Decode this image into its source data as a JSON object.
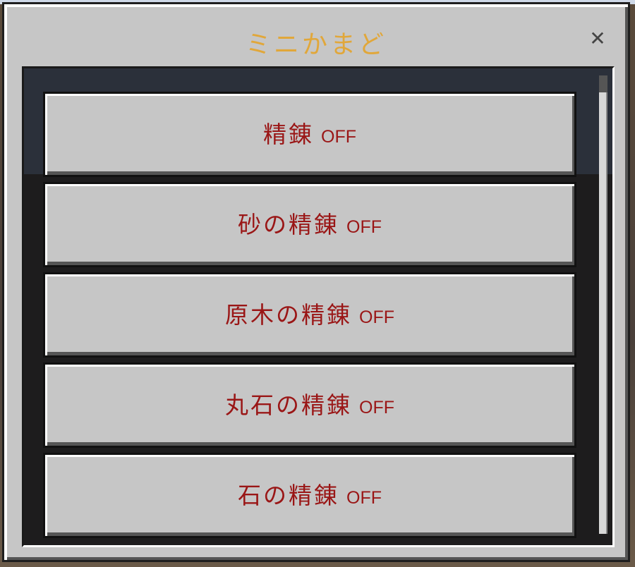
{
  "dialog": {
    "title": "ミニかまど",
    "close_icon": "close-icon",
    "close_glyph": "✕"
  },
  "options": [
    {
      "label": "精錬",
      "state": "OFF"
    },
    {
      "label": "砂の精錬",
      "state": "OFF"
    },
    {
      "label": "原木の精錬",
      "state": "OFF"
    },
    {
      "label": "丸石の精錬",
      "state": "OFF"
    },
    {
      "label": "石の精錬",
      "state": "OFF"
    }
  ],
  "colors": {
    "title": "#e1a73a",
    "option_text": "#9a1616",
    "dialog_bg": "#c6c6c6"
  }
}
